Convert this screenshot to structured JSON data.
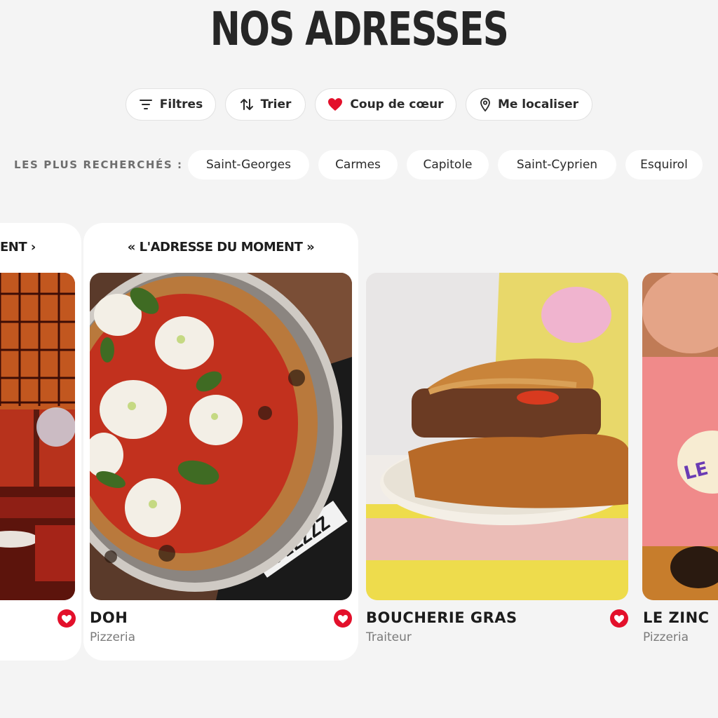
{
  "page": {
    "title": "NOS ADRESSES"
  },
  "toolbar": {
    "filters_label": "Filtres",
    "sort_label": "Trier",
    "favorite_label": "Coup de cœur",
    "locate_label": "Me localiser"
  },
  "popular": {
    "label": "LES PLUS RECHERCHÉS :",
    "chips": [
      "Saint-Georges",
      "Carmes",
      "Capitole",
      "Saint-Cyprien",
      "Esquirol"
    ]
  },
  "colors": {
    "accent_red": "#e3102b",
    "background": "#f4f4f4",
    "card": "#ffffff"
  },
  "cards": [
    {
      "featured_label": "ENT ›",
      "name": "",
      "type": "",
      "image": "restaurant interior with red walls and lattice ceiling"
    },
    {
      "featured_label": "« L'ADRESSE DU MOMENT »",
      "name": "DOH",
      "type": "Pizzeria",
      "image": "margherita pizza with burrata and basil"
    },
    {
      "name": "BOUCHERIE GRAS",
      "type": "Traiteur",
      "image": "meat pies on a plate"
    },
    {
      "name": "LE ZINC",
      "type": "Pizzeria",
      "image": "pizza on pink paper with LE ZINC sticker"
    }
  ]
}
